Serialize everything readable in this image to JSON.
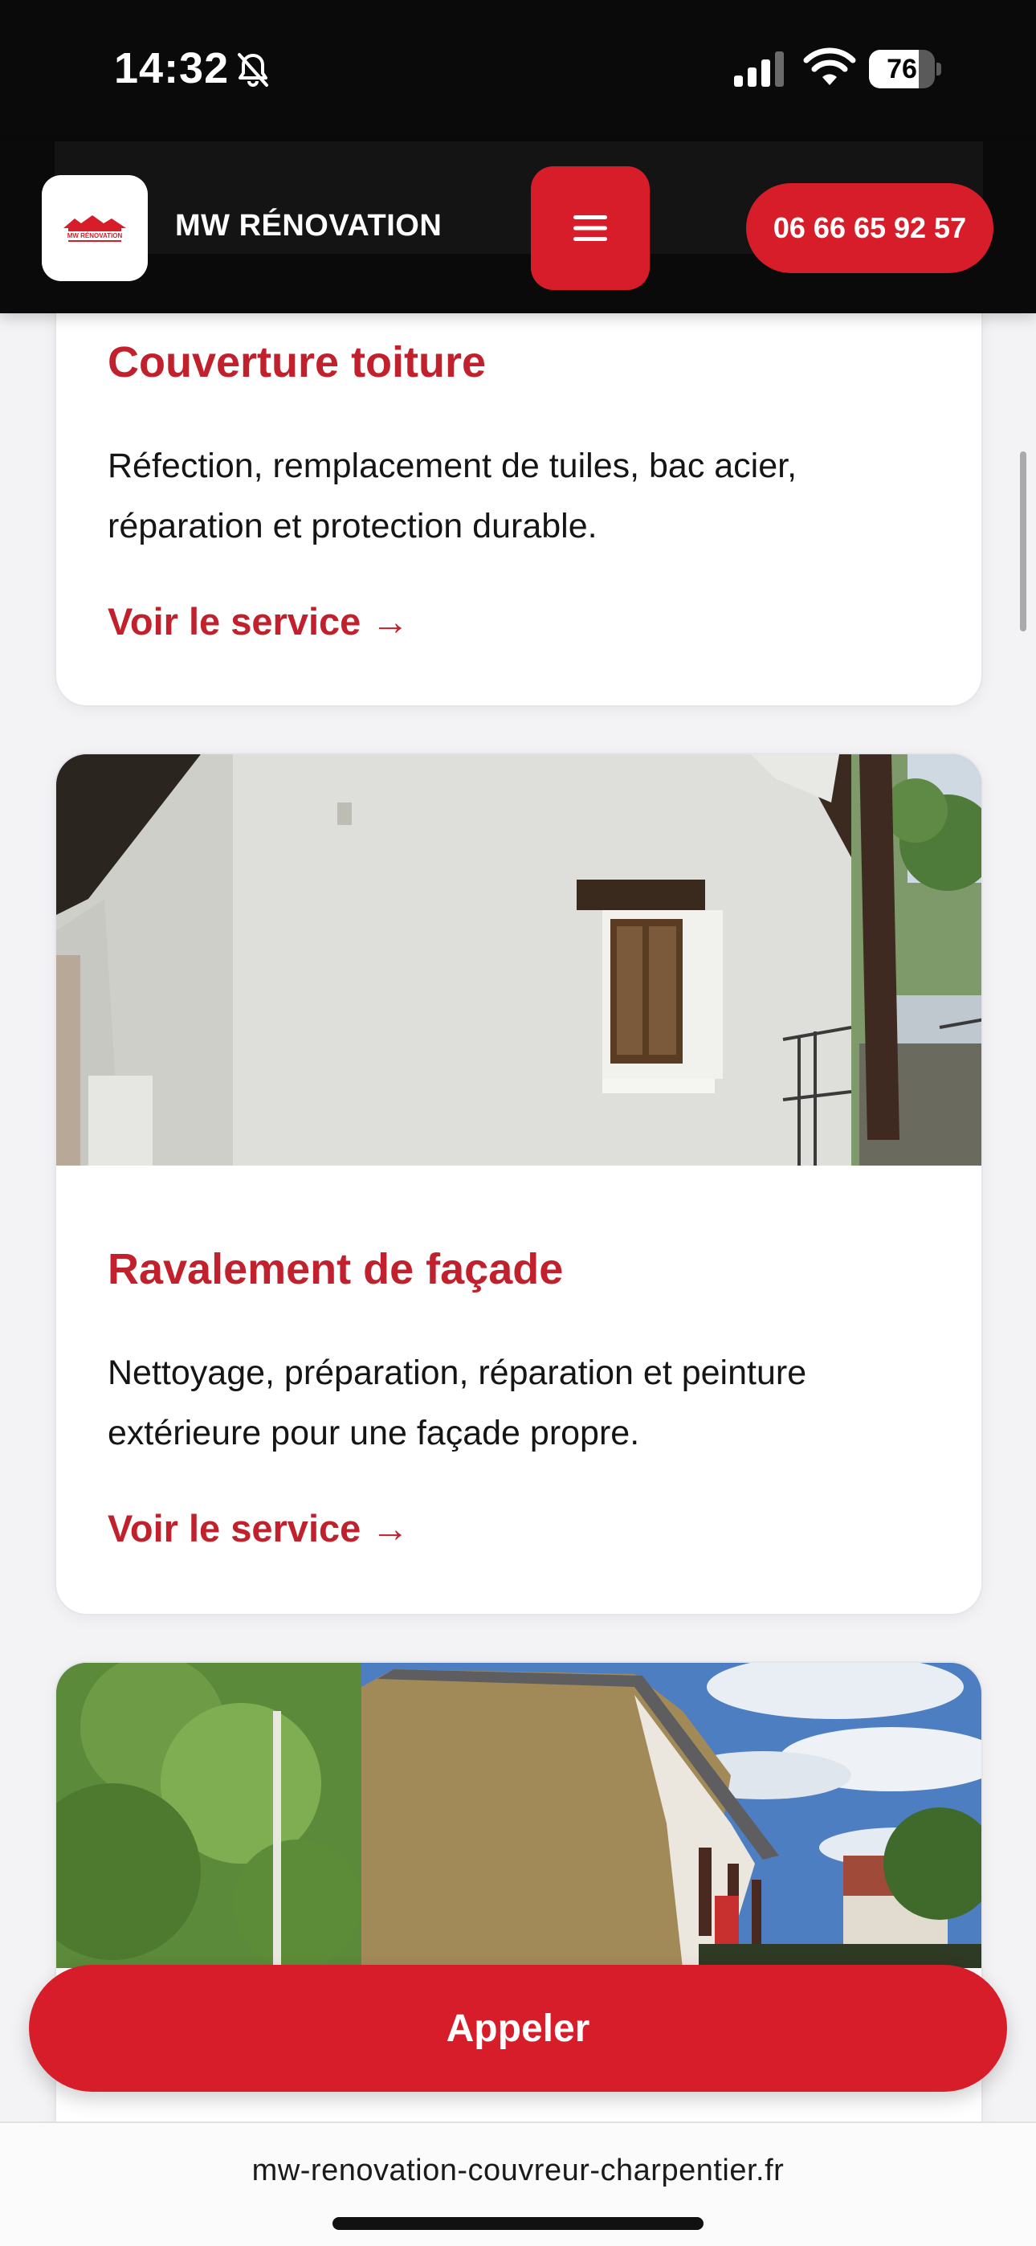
{
  "status_bar": {
    "time": "14:32",
    "battery": "76",
    "battery_level": 0.76,
    "icons": [
      "bell-slash-icon",
      "cellular-signal-icon",
      "wifi-icon",
      "battery-icon"
    ]
  },
  "header": {
    "logo_text": "MW RÉNOVATION",
    "brand": "MW RÉNOVATION",
    "menu_icon": "hamburger-menu-icon",
    "phone": "06 66 65 92 57"
  },
  "services": [
    {
      "title": "Couverture toiture",
      "description": "Réfection, remplacement de tuiles, bac acier, réparation et protection durable.",
      "link": "Voir le service →"
    },
    {
      "title": "Ravalement de façade",
      "description": "Nettoyage, préparation, réparation et peinture extérieure pour une façade propre.",
      "link": "Voir le service →"
    }
  ],
  "cta": {
    "label": "Appeler"
  },
  "browser": {
    "url": "mw-renovation-couvreur-charpentier.fr"
  },
  "colors": {
    "accent": "#d71d29",
    "title_red": "#c0212c",
    "header_bg": "#0a0a0a",
    "page_bg": "#f3f3f5"
  }
}
